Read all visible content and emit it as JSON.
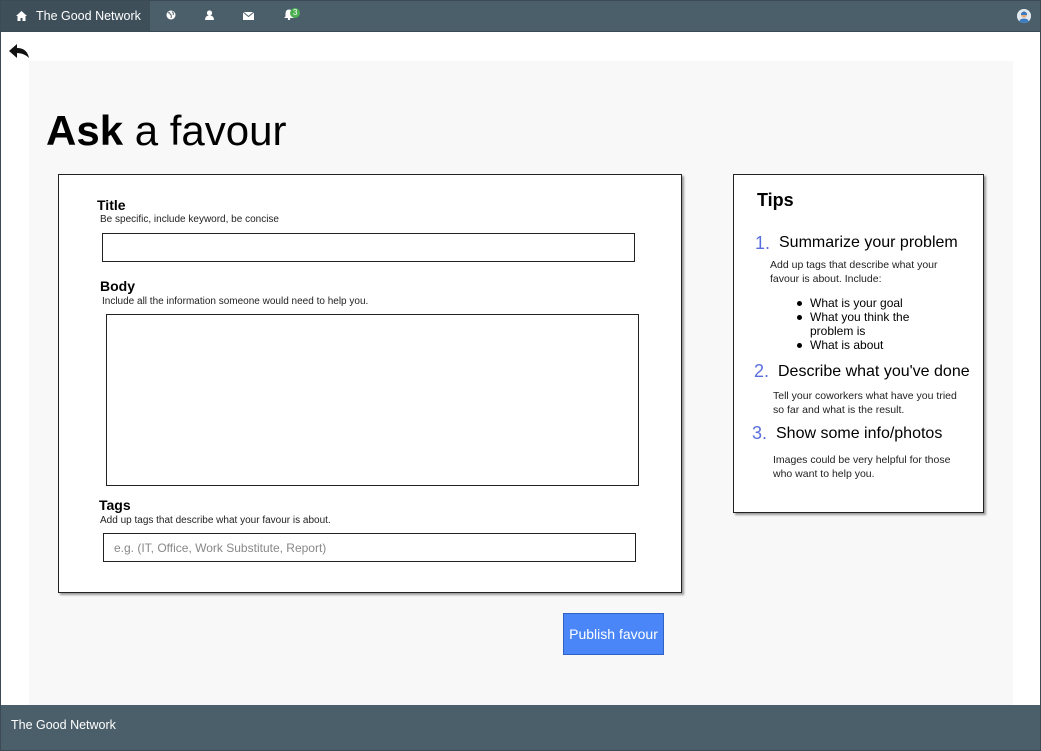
{
  "nav": {
    "brand": "The Good Network",
    "brand_icon": "home-icon",
    "icons": [
      "globe-icon",
      "user-icon",
      "envelope-icon",
      "bell-icon"
    ],
    "notification_count": "3",
    "avatar_icon": "avatar"
  },
  "page": {
    "title_bold": "Ask",
    "title_rest": " a favour"
  },
  "form": {
    "title_label": "Title",
    "title_hint": "Be specific, include keyword, be concise",
    "title_value": "",
    "body_label": "Body",
    "body_hint": "Include all the information someone would need to help you.",
    "body_value": "",
    "tags_label": "Tags",
    "tags_hint": "Add up tags that describe what your favour is about.",
    "tags_placeholder": "e.g. (IT, Office, Work Substitute, Report)",
    "publish_label": "Publish favour"
  },
  "tips": {
    "title": "Tips",
    "steps": [
      {
        "num": "1.",
        "heading": "Summarize your problem",
        "text": "Add up tags that describe what your favour is about. Include:",
        "bullets": [
          "What is your goal",
          "What you think the problem is",
          "What is about"
        ]
      },
      {
        "num": "2.",
        "heading": "Describe what you've done",
        "text": "Tell your coworkers what have you tried so far and what is the result."
      },
      {
        "num": "3.",
        "heading": "Show some info/photos",
        "text": "Images could be very helpful for those who want to help you."
      }
    ]
  },
  "footer": {
    "text": "The Good Network"
  },
  "colors": {
    "nav_bg": "#4b5f6b",
    "accent_blue": "#4a86f7",
    "step_number": "#5a6fdc",
    "badge_green": "#4caf50"
  }
}
